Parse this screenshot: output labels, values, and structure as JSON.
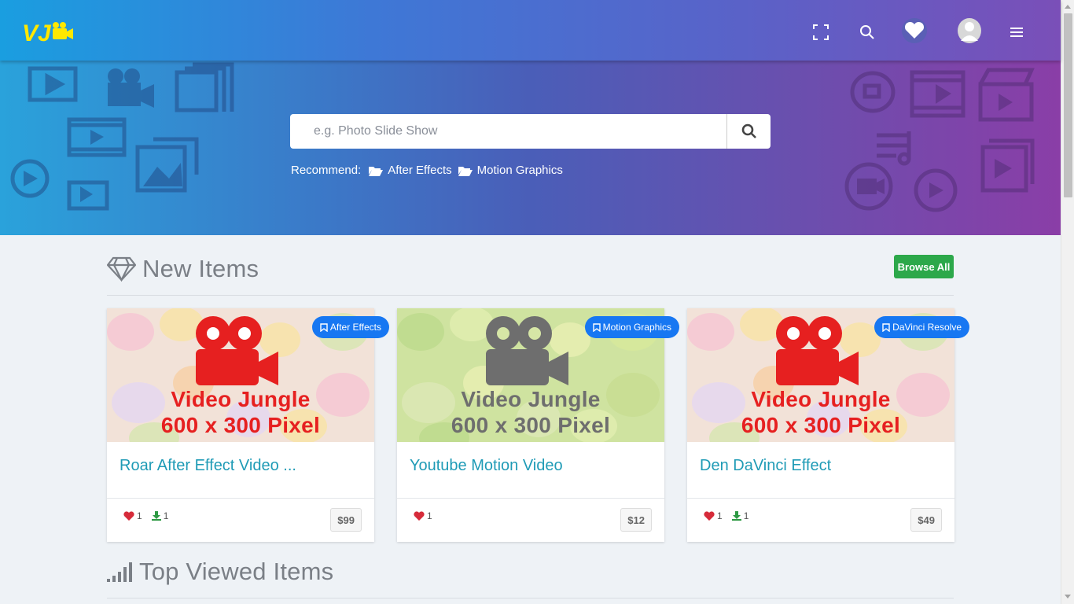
{
  "header": {
    "logo_text": "VJ",
    "icons": [
      "fullscreen-icon",
      "search-icon",
      "heart-icon",
      "user-avatar",
      "hamburger-menu-icon"
    ]
  },
  "hero": {
    "search_placeholder": "e.g. Photo Slide Show",
    "recommend_label": "Recommend:",
    "recommend_links": [
      "After Effects",
      "Motion Graphics"
    ]
  },
  "new_items": {
    "title": "New Items",
    "browse_label": "Browse All",
    "cards": [
      {
        "category": "After Effects",
        "thumb_line1": "Video Jungle",
        "thumb_line2": "600 x 300 Pixel",
        "title": "Roar After Effect Video ...",
        "likes": "1",
        "downloads": "1",
        "price": "$99",
        "accent": "#e62020",
        "bg": "#f3e4e8"
      },
      {
        "category": "Motion Graphics",
        "thumb_line1": "Video Jungle",
        "thumb_line2": "600 x 300 Pixel",
        "title": "Youtube Motion Video",
        "likes": "1",
        "downloads": null,
        "price": "$12",
        "accent": "#6e6e6e",
        "bg": "#d7eab2"
      },
      {
        "category": "DaVinci Resolve",
        "thumb_line1": "Video Jungle",
        "thumb_line2": "600 x 300 Pixel",
        "title": "Den DaVinci Effect",
        "likes": "1",
        "downloads": "1",
        "price": "$49",
        "accent": "#e62020",
        "bg": "#f3e4e8"
      }
    ]
  },
  "top_viewed": {
    "title": "Top Viewed Items"
  },
  "colors": {
    "badge": "#1777f2",
    "browse": "#2ca84a",
    "title_link": "#1f9bb6",
    "heart": "#d62b3a",
    "download": "#2e9a44"
  }
}
